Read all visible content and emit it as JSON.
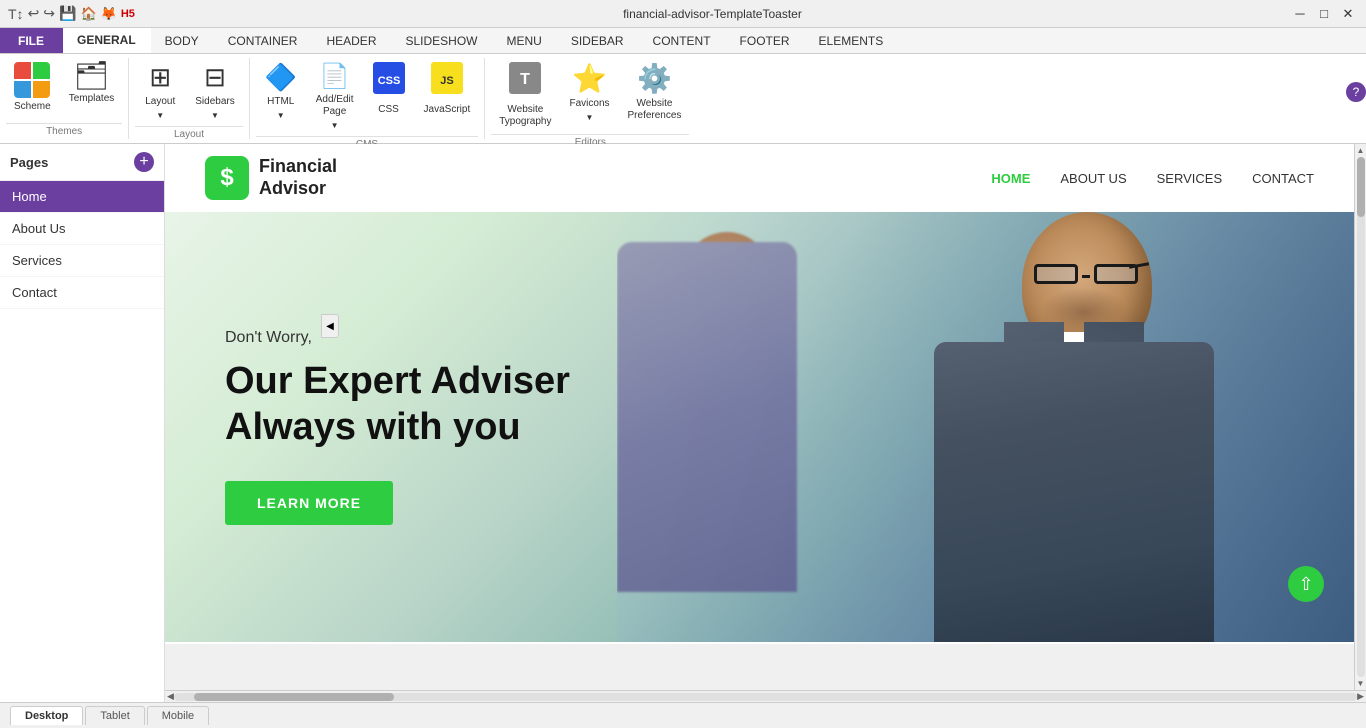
{
  "window": {
    "title": "financial-advisor-TemplateToaster",
    "min_label": "─",
    "max_label": "□",
    "close_label": "✕"
  },
  "toolbar_icons": {
    "undo": "↩",
    "redo": "↪",
    "save": "💾",
    "home": "🏠",
    "firefox": "🦊",
    "h5": "H5",
    "arrow": "↕"
  },
  "ribbon_tabs": [
    {
      "id": "file",
      "label": "FILE",
      "active": false,
      "is_file": true
    },
    {
      "id": "general",
      "label": "GENERAL",
      "active": true
    },
    {
      "id": "body",
      "label": "BODY"
    },
    {
      "id": "container",
      "label": "CONTAINER"
    },
    {
      "id": "header",
      "label": "HEADER"
    },
    {
      "id": "slideshow",
      "label": "SLIDESHOW"
    },
    {
      "id": "menu",
      "label": "MENU"
    },
    {
      "id": "sidebar",
      "label": "SIDEBAR"
    },
    {
      "id": "content",
      "label": "CONTENT"
    },
    {
      "id": "footer",
      "label": "FOOTER"
    },
    {
      "id": "elements",
      "label": "ELEMENTS"
    }
  ],
  "ribbon_groups": {
    "themes": {
      "label": "Themes",
      "items": [
        {
          "id": "scheme",
          "label": "Scheme"
        },
        {
          "id": "templates",
          "label": "Templates"
        }
      ]
    },
    "layout": {
      "label": "Layout",
      "items": [
        {
          "id": "layout",
          "label": "Layout"
        },
        {
          "id": "sidebars",
          "label": "Sidebars"
        }
      ]
    },
    "cms": {
      "label": "CMS",
      "items": [
        {
          "id": "html",
          "label": "HTML"
        },
        {
          "id": "add_edit",
          "label": "Add/Edit\nPage"
        },
        {
          "id": "css",
          "label": "CSS"
        },
        {
          "id": "javascript",
          "label": "JavaScript"
        }
      ]
    },
    "editors": {
      "label": "Editors",
      "items": [
        {
          "id": "typography",
          "label": "Website\nTypography"
        },
        {
          "id": "favicons",
          "label": "Favicons"
        },
        {
          "id": "preferences",
          "label": "Website\nPreferences"
        }
      ]
    }
  },
  "sidebar": {
    "title": "Pages",
    "add_btn": "+",
    "pages": [
      {
        "id": "home",
        "label": "Home",
        "active": true
      },
      {
        "id": "about",
        "label": "About Us"
      },
      {
        "id": "services",
        "label": "Services"
      },
      {
        "id": "contact",
        "label": "Contact"
      }
    ]
  },
  "site": {
    "logo_icon": "$",
    "logo_text": "Financial\nAdvisor",
    "nav_items": [
      {
        "id": "home",
        "label": "HOME",
        "active": true
      },
      {
        "id": "about",
        "label": "ABOUT US"
      },
      {
        "id": "services",
        "label": "SERVICES"
      },
      {
        "id": "contact",
        "label": "CONTACT"
      }
    ],
    "hero": {
      "sub": "Don't Worry,",
      "title": "Our Expert Adviser\nAlways with you",
      "btn_label": "LEARN MORE"
    }
  },
  "bottom_tabs": [
    {
      "id": "desktop",
      "label": "Desktop",
      "active": true
    },
    {
      "id": "tablet",
      "label": "Tablet"
    },
    {
      "id": "mobile",
      "label": "Mobile"
    }
  ],
  "colors": {
    "purple": "#6a3fa0",
    "green": "#2ecc40",
    "active_page_bg": "#6a3fa0",
    "nav_active": "#2ecc40"
  }
}
